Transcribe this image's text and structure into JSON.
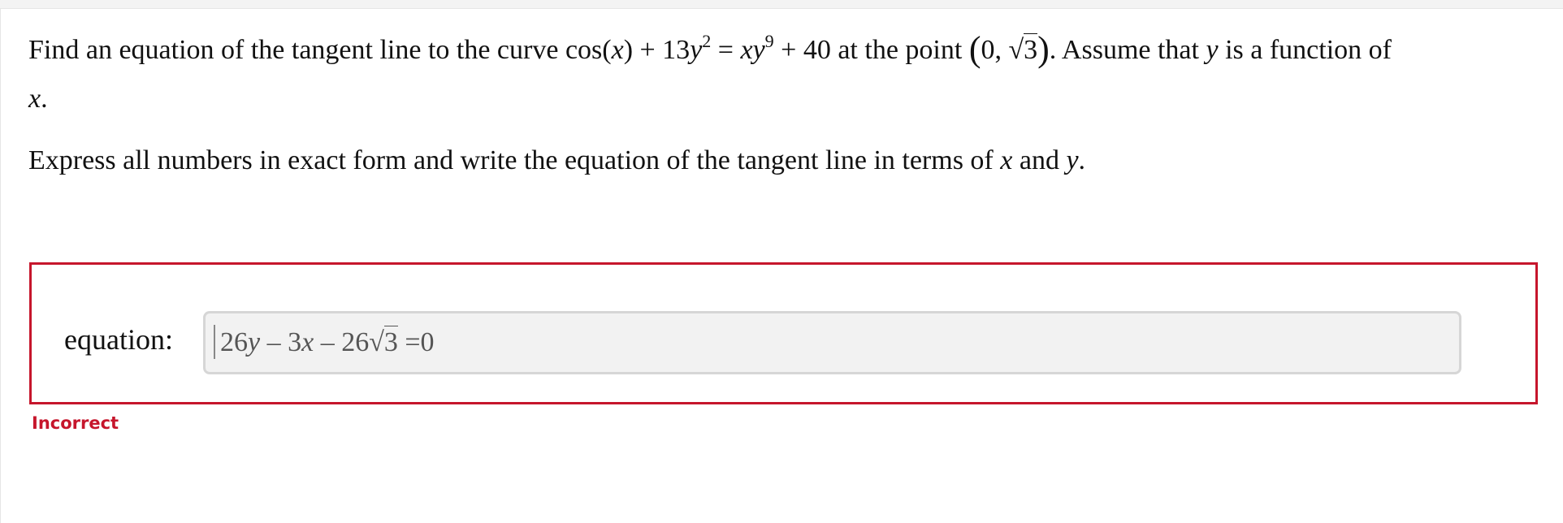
{
  "problem": {
    "text_before_curve": "Find an equation of the tangent line to the curve ",
    "curve": {
      "cos_prefix": "cos(",
      "x_var": "x",
      "cos_suffix": ") + 13",
      "y_var": "y",
      "exp1": "2",
      "equals": " = ",
      "x2_var": "x",
      "y2_var": "y",
      "exp2": "9",
      "tail": " + 40"
    },
    "text_at_point": " at the point ",
    "point": {
      "open": "(",
      "x": "0",
      "sep": ", ",
      "sqrt_sym": "√",
      "radicand": "3",
      "close": ")"
    },
    "text_after_point": ". Assume that ",
    "assume_var": "y",
    "text_function_of": " is a function of",
    "line2_var": "x",
    "line2_period": ".",
    "instruction_prefix": "Express all numbers in exact form and write the equation of the tangent line in terms of ",
    "instruction_var_x": "x",
    "instruction_and": " and ",
    "instruction_var_y": "y",
    "instruction_period": "."
  },
  "answer": {
    "label": "equation:",
    "value": {
      "coef1": "26",
      "var1": "y",
      "minus1": " – 3",
      "var2": "x",
      "minus2": " – 26",
      "sqrt_sym": "√",
      "radicand": "3",
      "rhs": " =0"
    },
    "status": "Incorrect"
  },
  "colors": {
    "error": "#c6162c",
    "field_bg": "#f2f2f2",
    "field_border": "#d6d6d6"
  }
}
